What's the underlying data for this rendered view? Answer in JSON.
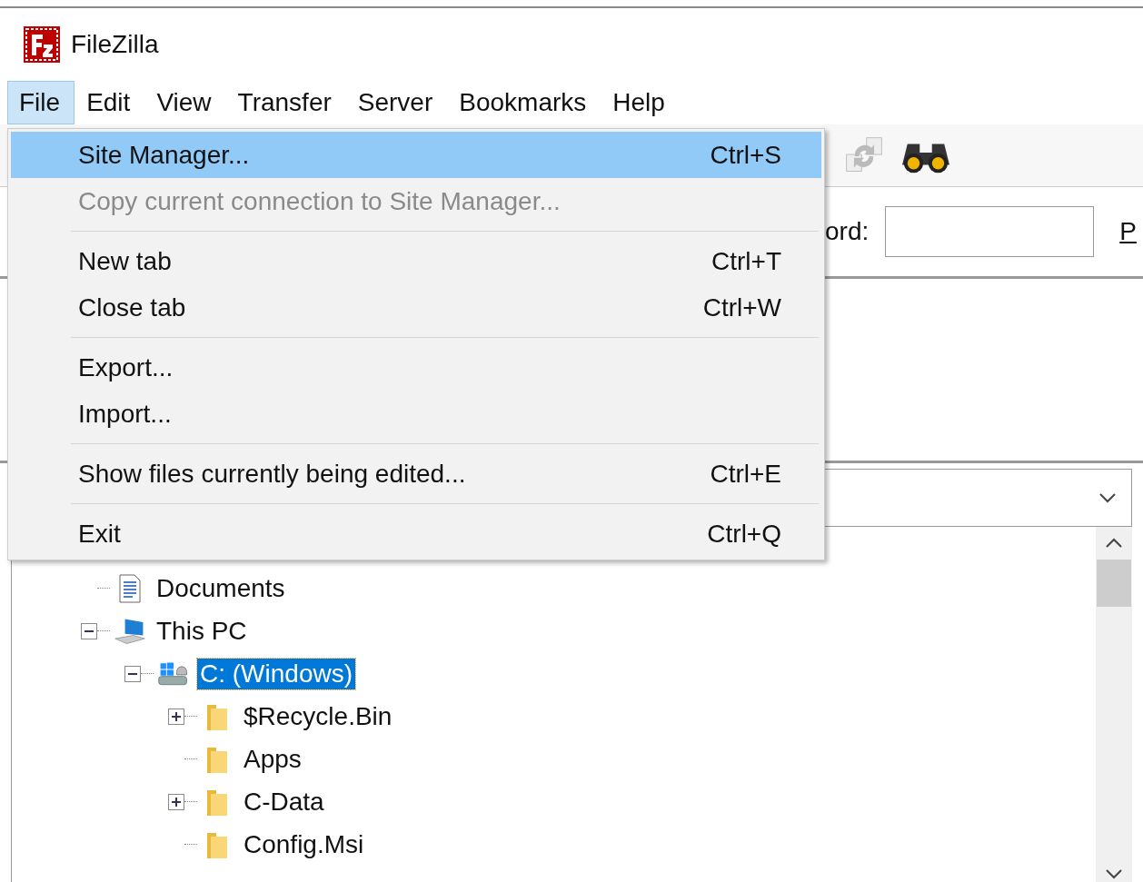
{
  "window": {
    "title": "FileZilla"
  },
  "menubar": [
    {
      "label": "File",
      "selected": true
    },
    {
      "label": "Edit",
      "selected": false
    },
    {
      "label": "View",
      "selected": false
    },
    {
      "label": "Transfer",
      "selected": false
    },
    {
      "label": "Server",
      "selected": false
    },
    {
      "label": "Bookmarks",
      "selected": false
    },
    {
      "label": "Help",
      "selected": false
    }
  ],
  "file_menu": [
    {
      "kind": "item",
      "label": "Site Manager...",
      "shortcut": "Ctrl+S",
      "selected": true,
      "disabled": false
    },
    {
      "kind": "item",
      "label": "Copy current connection to Site Manager...",
      "selected": false,
      "disabled": true
    },
    {
      "kind": "separator"
    },
    {
      "kind": "item",
      "label": "New tab",
      "shortcut": "Ctrl+T",
      "selected": false,
      "disabled": false
    },
    {
      "kind": "item",
      "label": "Close tab",
      "shortcut": "Ctrl+W",
      "selected": false,
      "disabled": false
    },
    {
      "kind": "separator"
    },
    {
      "kind": "item",
      "label": "Export...",
      "selected": false,
      "disabled": false
    },
    {
      "kind": "item",
      "label": "Import...",
      "selected": false,
      "disabled": false
    },
    {
      "kind": "separator"
    },
    {
      "kind": "item",
      "label": "Show files currently being edited...",
      "shortcut": "Ctrl+E",
      "selected": false,
      "disabled": false
    },
    {
      "kind": "separator"
    },
    {
      "kind": "item",
      "label": "Exit",
      "shortcut": "Ctrl+Q",
      "selected": false,
      "disabled": false
    }
  ],
  "quickconnect": {
    "password_label": "ord:",
    "port_label": "P"
  },
  "tree": {
    "items": [
      {
        "label": "Documents",
        "kind": "document",
        "selected": false
      },
      {
        "label": "This PC",
        "kind": "computer",
        "selected": false,
        "expanded": true,
        "children": [
          {
            "label": "C: (Windows)",
            "kind": "drive",
            "selected": true,
            "expanded": true,
            "children": [
              {
                "label": "$Recycle.Bin",
                "kind": "folder",
                "selected": false,
                "expanded": false
              },
              {
                "label": "Apps",
                "kind": "folder",
                "selected": false
              },
              {
                "label": "C-Data",
                "kind": "folder",
                "selected": false,
                "expanded": false
              },
              {
                "label": "Config.Msi",
                "kind": "folder",
                "selected": false
              }
            ]
          }
        ]
      }
    ]
  }
}
